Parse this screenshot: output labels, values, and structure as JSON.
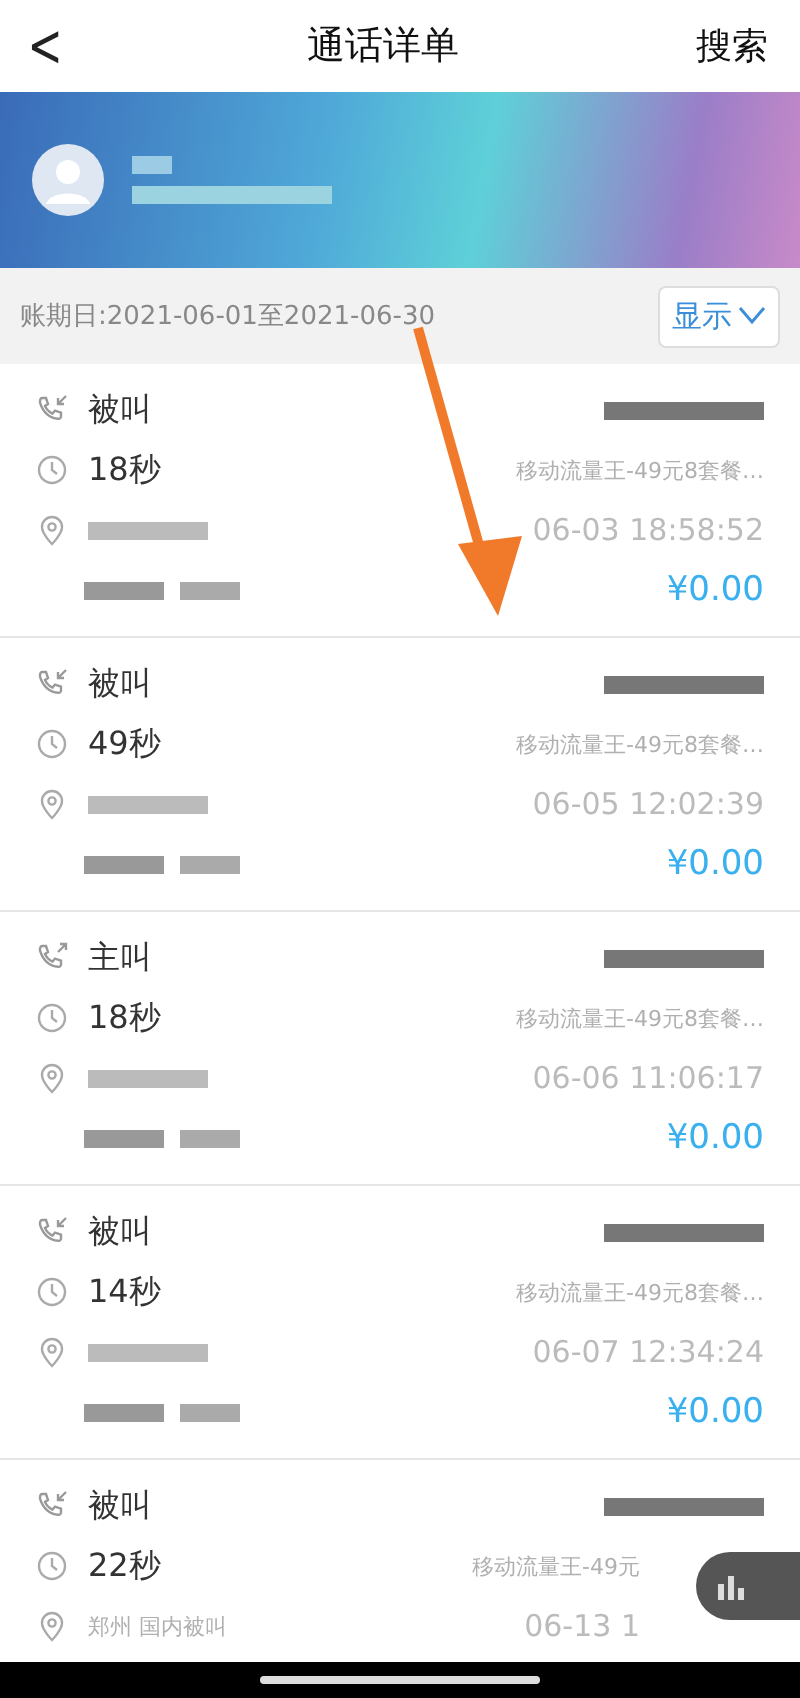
{
  "header": {
    "back": "<",
    "title": "通话详单",
    "action": "搜索"
  },
  "filter": {
    "period": "账期日:2021-06-01至2021-06-30",
    "button": "显示"
  },
  "records": [
    {
      "kind": "incoming",
      "type": "被叫",
      "duration": "18秒",
      "package": "移动流量王-49元8套餐…",
      "date": "06-03 18:58:52",
      "amount": "¥0.00"
    },
    {
      "kind": "incoming",
      "type": "被叫",
      "duration": "49秒",
      "package": "移动流量王-49元8套餐…",
      "date": "06-05 12:02:39",
      "amount": "¥0.00"
    },
    {
      "kind": "outgoing",
      "type": "主叫",
      "duration": "18秒",
      "package": "移动流量王-49元8套餐…",
      "date": "06-06 11:06:17",
      "amount": "¥0.00"
    },
    {
      "kind": "incoming",
      "type": "被叫",
      "duration": "14秒",
      "package": "移动流量王-49元8套餐…",
      "date": "06-07 12:34:24",
      "amount": "¥0.00"
    },
    {
      "kind": "incoming",
      "type": "被叫",
      "duration": "22秒",
      "package": "移动流量王-49元",
      "location": "郑州   国内被叫",
      "date": "06-13 1"
    }
  ]
}
